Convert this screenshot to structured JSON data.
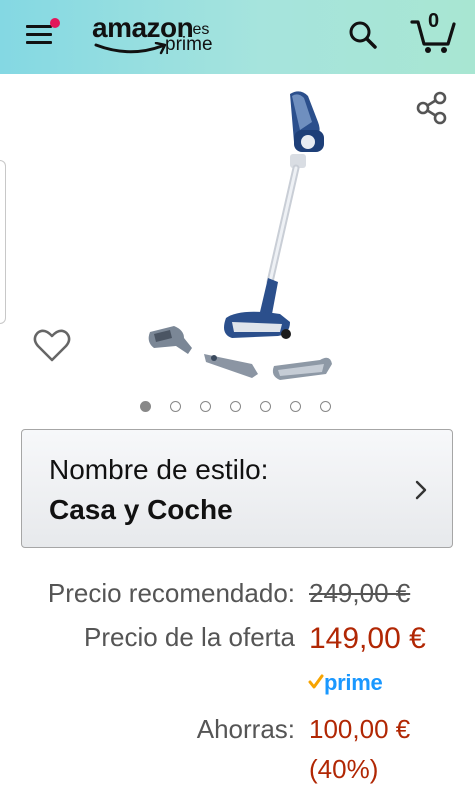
{
  "header": {
    "logo_word": "amazon",
    "logo_tld": ".es",
    "logo_sub": "prime",
    "cart_count": "0",
    "icons": {
      "menu": "hamburger-icon",
      "search": "search-icon",
      "cart": "cart-icon"
    },
    "notification_color": "#e3165b"
  },
  "gallery": {
    "image": "cordless-stick-vacuum-with-accessories",
    "icons": {
      "share": "share-icon",
      "wishlist": "heart-outline-icon"
    },
    "dots_total": 7,
    "active_dot": 0
  },
  "style": {
    "label": "Nombre de estilo:",
    "value": "Casa y Coche"
  },
  "pricing": {
    "list_label": "Precio recomendado:",
    "list_price": "249,00 €",
    "deal_label": "Precio de la oferta",
    "deal_price": "149,00 €",
    "prime_label": "prime",
    "savings_label": "Ahorras:",
    "savings_amount": "100,00 €",
    "savings_percent": "(40%)",
    "accent_color": "#b12704",
    "prime_color": "#1a98ff"
  }
}
